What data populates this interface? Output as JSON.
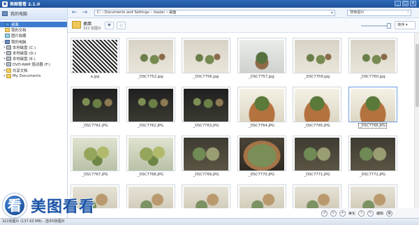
{
  "app": {
    "title": "美图看看 2.1.0"
  },
  "window_buttons": [
    "_",
    "□",
    "×"
  ],
  "sidebar": {
    "root_label": "我的电脑",
    "items": [
      {
        "label": "桌面",
        "icon": "desktop-icon",
        "selected": true,
        "indent": 1
      },
      {
        "label": "我的文档",
        "icon": "documents-icon",
        "indent": 1
      },
      {
        "label": "图片收藏",
        "icon": "pictures-icon",
        "indent": 1
      },
      {
        "label": "我的电脑",
        "icon": "computer-icon",
        "indent": 1,
        "expand": "−"
      },
      {
        "label": "本地磁盘 (C:)",
        "icon": "drive-icon",
        "indent": 2,
        "expand": "+"
      },
      {
        "label": "本地磁盘 (D:)",
        "icon": "drive-icon",
        "indent": 2,
        "expand": "+"
      },
      {
        "label": "本地磁盘 (E:)",
        "icon": "drive-icon",
        "indent": 2,
        "expand": "+"
      },
      {
        "label": "DVD-RAM 驱动器 (F:)",
        "icon": "dvd-drive-icon",
        "indent": 2,
        "expand": "+"
      },
      {
        "label": "共享文档",
        "icon": "folder-icon",
        "indent": 2,
        "expand": "+"
      },
      {
        "label": "My Documents",
        "icon": "folder-icon",
        "indent": 2,
        "expand": "+"
      }
    ]
  },
  "toolbar": {
    "back_icon": "←",
    "forward_icon": "→",
    "address": "C:  ›  Documents and Settings  ›  ‹kasle›  ›  桌面",
    "go_icon": "▾",
    "search_placeholder": "搜索图片",
    "search_icon": "⌕"
  },
  "folder": {
    "name": "桌面",
    "count": "322 张图片",
    "btn_heart": "♥",
    "btn_slideshow": "◇",
    "sort_label": "排序 ▾"
  },
  "thumbnails": [
    {
      "name": "a.jpg",
      "style": "bw"
    },
    {
      "name": "_DSC7752.jpg",
      "style": "ph1"
    },
    {
      "name": "_DSC7756.jpg",
      "style": "ph1"
    },
    {
      "name": "_DSC7757.jpg",
      "style": "ph2"
    },
    {
      "name": "_DSC7759.jpg",
      "style": "ph1"
    },
    {
      "name": "_DSC7760.jpg",
      "style": "ph1"
    },
    {
      "name": "_DSC7761.JPG",
      "style": "ph3"
    },
    {
      "name": "_DSC7762.JPG",
      "style": "ph3"
    },
    {
      "name": "_DSC7763.JPG",
      "style": "ph3"
    },
    {
      "name": "_DSC7764.JPG",
      "style": "ph4"
    },
    {
      "name": "_DSC7765.JPG",
      "style": "ph4"
    },
    {
      "name": "_DSC7766.JPG",
      "style": "ph4",
      "selected": true
    },
    {
      "name": "_DSC7767.JPG",
      "style": "ph5"
    },
    {
      "name": "_DSC7768.JPG",
      "style": "ph5"
    },
    {
      "name": "_DSC7769.JPG",
      "style": "ph6"
    },
    {
      "name": "_DSC7770.JPG",
      "style": "ph7"
    },
    {
      "name": "_DSC7771.JPG",
      "style": "ph6"
    },
    {
      "name": "_DSC7772.JPG",
      "style": "ph6"
    },
    {
      "name": "",
      "style": "ph8"
    },
    {
      "name": "",
      "style": "ph8"
    },
    {
      "name": "",
      "style": "ph8"
    },
    {
      "name": "",
      "style": "ph8"
    },
    {
      "name": "",
      "style": "ph8"
    },
    {
      "name": "",
      "style": "ph8"
    }
  ],
  "bottom": {
    "btn_meihua": "美化",
    "btn_edit": "编辑"
  },
  "status": "322张图片 (137.63 MB) - 选中0张图片",
  "brand": {
    "logo_char": "看",
    "text": "美图看看"
  }
}
